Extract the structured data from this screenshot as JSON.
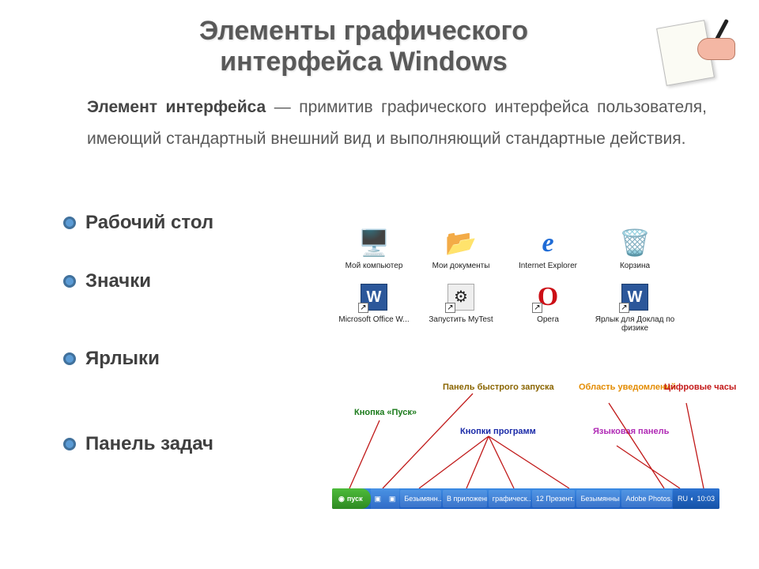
{
  "title_line1": "Элементы графического",
  "title_line2": "интерфейса Windows",
  "definition_lead": "Элемент интерфейса",
  "definition_rest": " — примитив графического интерфейса пользователя, имеющий стандартный внешний вид и выполняющий стандартные действия.",
  "bullets": {
    "b1": "Рабочий стол",
    "b2": "Значки",
    "b3": "Ярлыки",
    "b4": "Панель задач"
  },
  "desktop_icons_row1": [
    {
      "label": "Мой компьютер",
      "glyph": "🖥️"
    },
    {
      "label": "Мои документы",
      "glyph": "📂"
    },
    {
      "label": "Internet Explorer",
      "glyph": "🌐"
    },
    {
      "label": "Корзина",
      "glyph": "🗑️"
    }
  ],
  "desktop_icons_row2": [
    {
      "label": "Microsoft Office W...",
      "glyph": "W"
    },
    {
      "label": "Запустить MyTest",
      "glyph": "⚙"
    },
    {
      "label": "Opera",
      "glyph": "O"
    },
    {
      "label": "Ярлык для Доклад по физике",
      "glyph": "W"
    }
  ],
  "tb_labels": {
    "start": "Кнопка «Пуск»",
    "quick": "Панель быстрого запуска",
    "notify": "Область уведомлений",
    "clock": "Цифровые часы",
    "programs": "Кнопки программ",
    "lang": "Языковая панель"
  },
  "taskbar": {
    "start": "пуск",
    "buttons": [
      "Безымянн...",
      "В приложени",
      "графическ...",
      "12 Презент...",
      "Безымянный",
      "Adobe Photos..."
    ],
    "lang": "RU",
    "clock": "10:03"
  }
}
